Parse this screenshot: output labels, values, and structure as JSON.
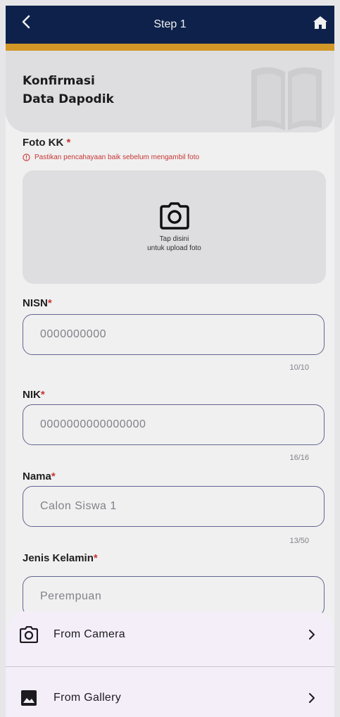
{
  "appbar": {
    "title": "Step 1"
  },
  "header": {
    "title": "Konfirmasi\nData Dapodik"
  },
  "foto_kk": {
    "label": "Foto KK",
    "required_mark": "*",
    "warning": "Pastikan pencahayaan baik sebelum mengambil foto",
    "upload_hint": "Tap disini\nuntuk upload foto"
  },
  "nisn": {
    "label": "NISN",
    "required_mark": "*",
    "value": "0000000000",
    "counter": "10/10"
  },
  "nik": {
    "label": "NIK",
    "required_mark": "*",
    "value": "0000000000000000",
    "counter": "16/16"
  },
  "nama": {
    "label": "Nama",
    "required_mark": "*",
    "value": "Calon Siswa 1",
    "counter": "13/50"
  },
  "jenis_kelamin": {
    "label": "Jenis Kelamin",
    "required_mark": "*",
    "value": "Perempuan"
  },
  "sheet": {
    "camera_label": "From Camera",
    "gallery_label": "From Gallery"
  },
  "colors": {
    "appbar": "#0e2450",
    "accent": "#e0a12a",
    "required": "#d53a3a",
    "sheet": "#f3eef8"
  },
  "icons": {
    "back": "chevron-left-icon",
    "home": "home-icon",
    "camera": "camera-icon",
    "gallery": "image-icon",
    "chevron": "chevron-right-icon"
  }
}
